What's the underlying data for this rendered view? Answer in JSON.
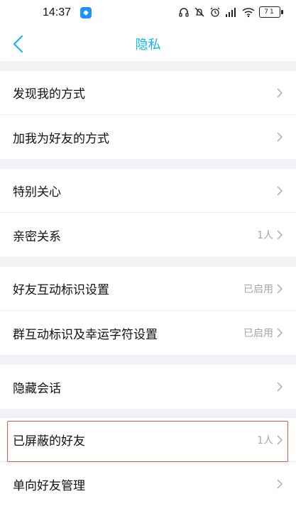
{
  "status_bar": {
    "time": "14:37",
    "battery": "71",
    "icons": [
      "headphone-icon",
      "notifications-off-icon",
      "alarm-icon",
      "signal-icon",
      "wifi-icon",
      "battery-icon"
    ]
  },
  "nav": {
    "title": "隐私",
    "accent_color": "#12b7f5"
  },
  "groups": [
    {
      "items": [
        {
          "label": "发现我的方式",
          "value": ""
        },
        {
          "label": "加我为好友的方式",
          "value": ""
        }
      ]
    },
    {
      "items": [
        {
          "label": "特别关心",
          "value": ""
        },
        {
          "label": "亲密关系",
          "value": "1人"
        }
      ]
    },
    {
      "items": [
        {
          "label": "好友互动标识设置",
          "value": "已启用"
        },
        {
          "label": "群互动标识及幸运字符设置",
          "value": "已启用"
        }
      ]
    },
    {
      "items": [
        {
          "label": "隐藏会话",
          "value": ""
        }
      ]
    },
    {
      "items": [
        {
          "label": "已屏蔽的好友",
          "value": "1人",
          "highlighted": true
        },
        {
          "label": "单向好友管理",
          "value": ""
        }
      ]
    }
  ]
}
